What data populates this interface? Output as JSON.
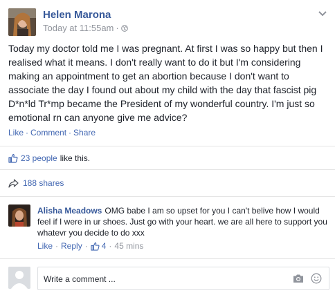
{
  "post": {
    "author": "Helen Marona",
    "timestamp": "Today at 11:55am",
    "timestamp_sep": "·",
    "privacy_icon": "globe-icon",
    "menu_icon": "chevron-down-icon",
    "text": "Today my doctor told me I was pregnant. At first I was so happy but then I realised what it means. I don't really want to do it but I'm considering making an appointment to get an abortion because I don't want to associate the day I found out about my child with the day that fascist pig D*n*ld Tr*mp became the President of my wonderful country. I'm just so emotional rn can anyone give me advice?",
    "actions": [
      "Like",
      "Comment",
      "Share"
    ],
    "action_sep": "·"
  },
  "reactions": {
    "icon": "thumbs-up-icon",
    "count_label": "23 people",
    "tail": "like this."
  },
  "shares": {
    "icon": "share-arrow-icon",
    "label": "188 shares"
  },
  "comment": {
    "author": "Alisha Meadows",
    "text": "OMG babe I am so upset for you I can't belive how I would feel if I were in ur shoes. Just go with your heart. we are all here to support you whatevr you decide to do xxx",
    "like": "Like",
    "reply": "Reply",
    "sep": "·",
    "like_icon": "thumbs-up-icon",
    "like_count": "4",
    "time": "45 mins"
  },
  "composer": {
    "placeholder": "Write a comment ...",
    "camera_icon": "camera-icon",
    "emoji_icon": "smiley-icon"
  },
  "colors": {
    "link": "#365899",
    "action": "#4267b2",
    "meta": "#90949c",
    "text": "#1d2129",
    "divider": "#e5e5e5"
  }
}
